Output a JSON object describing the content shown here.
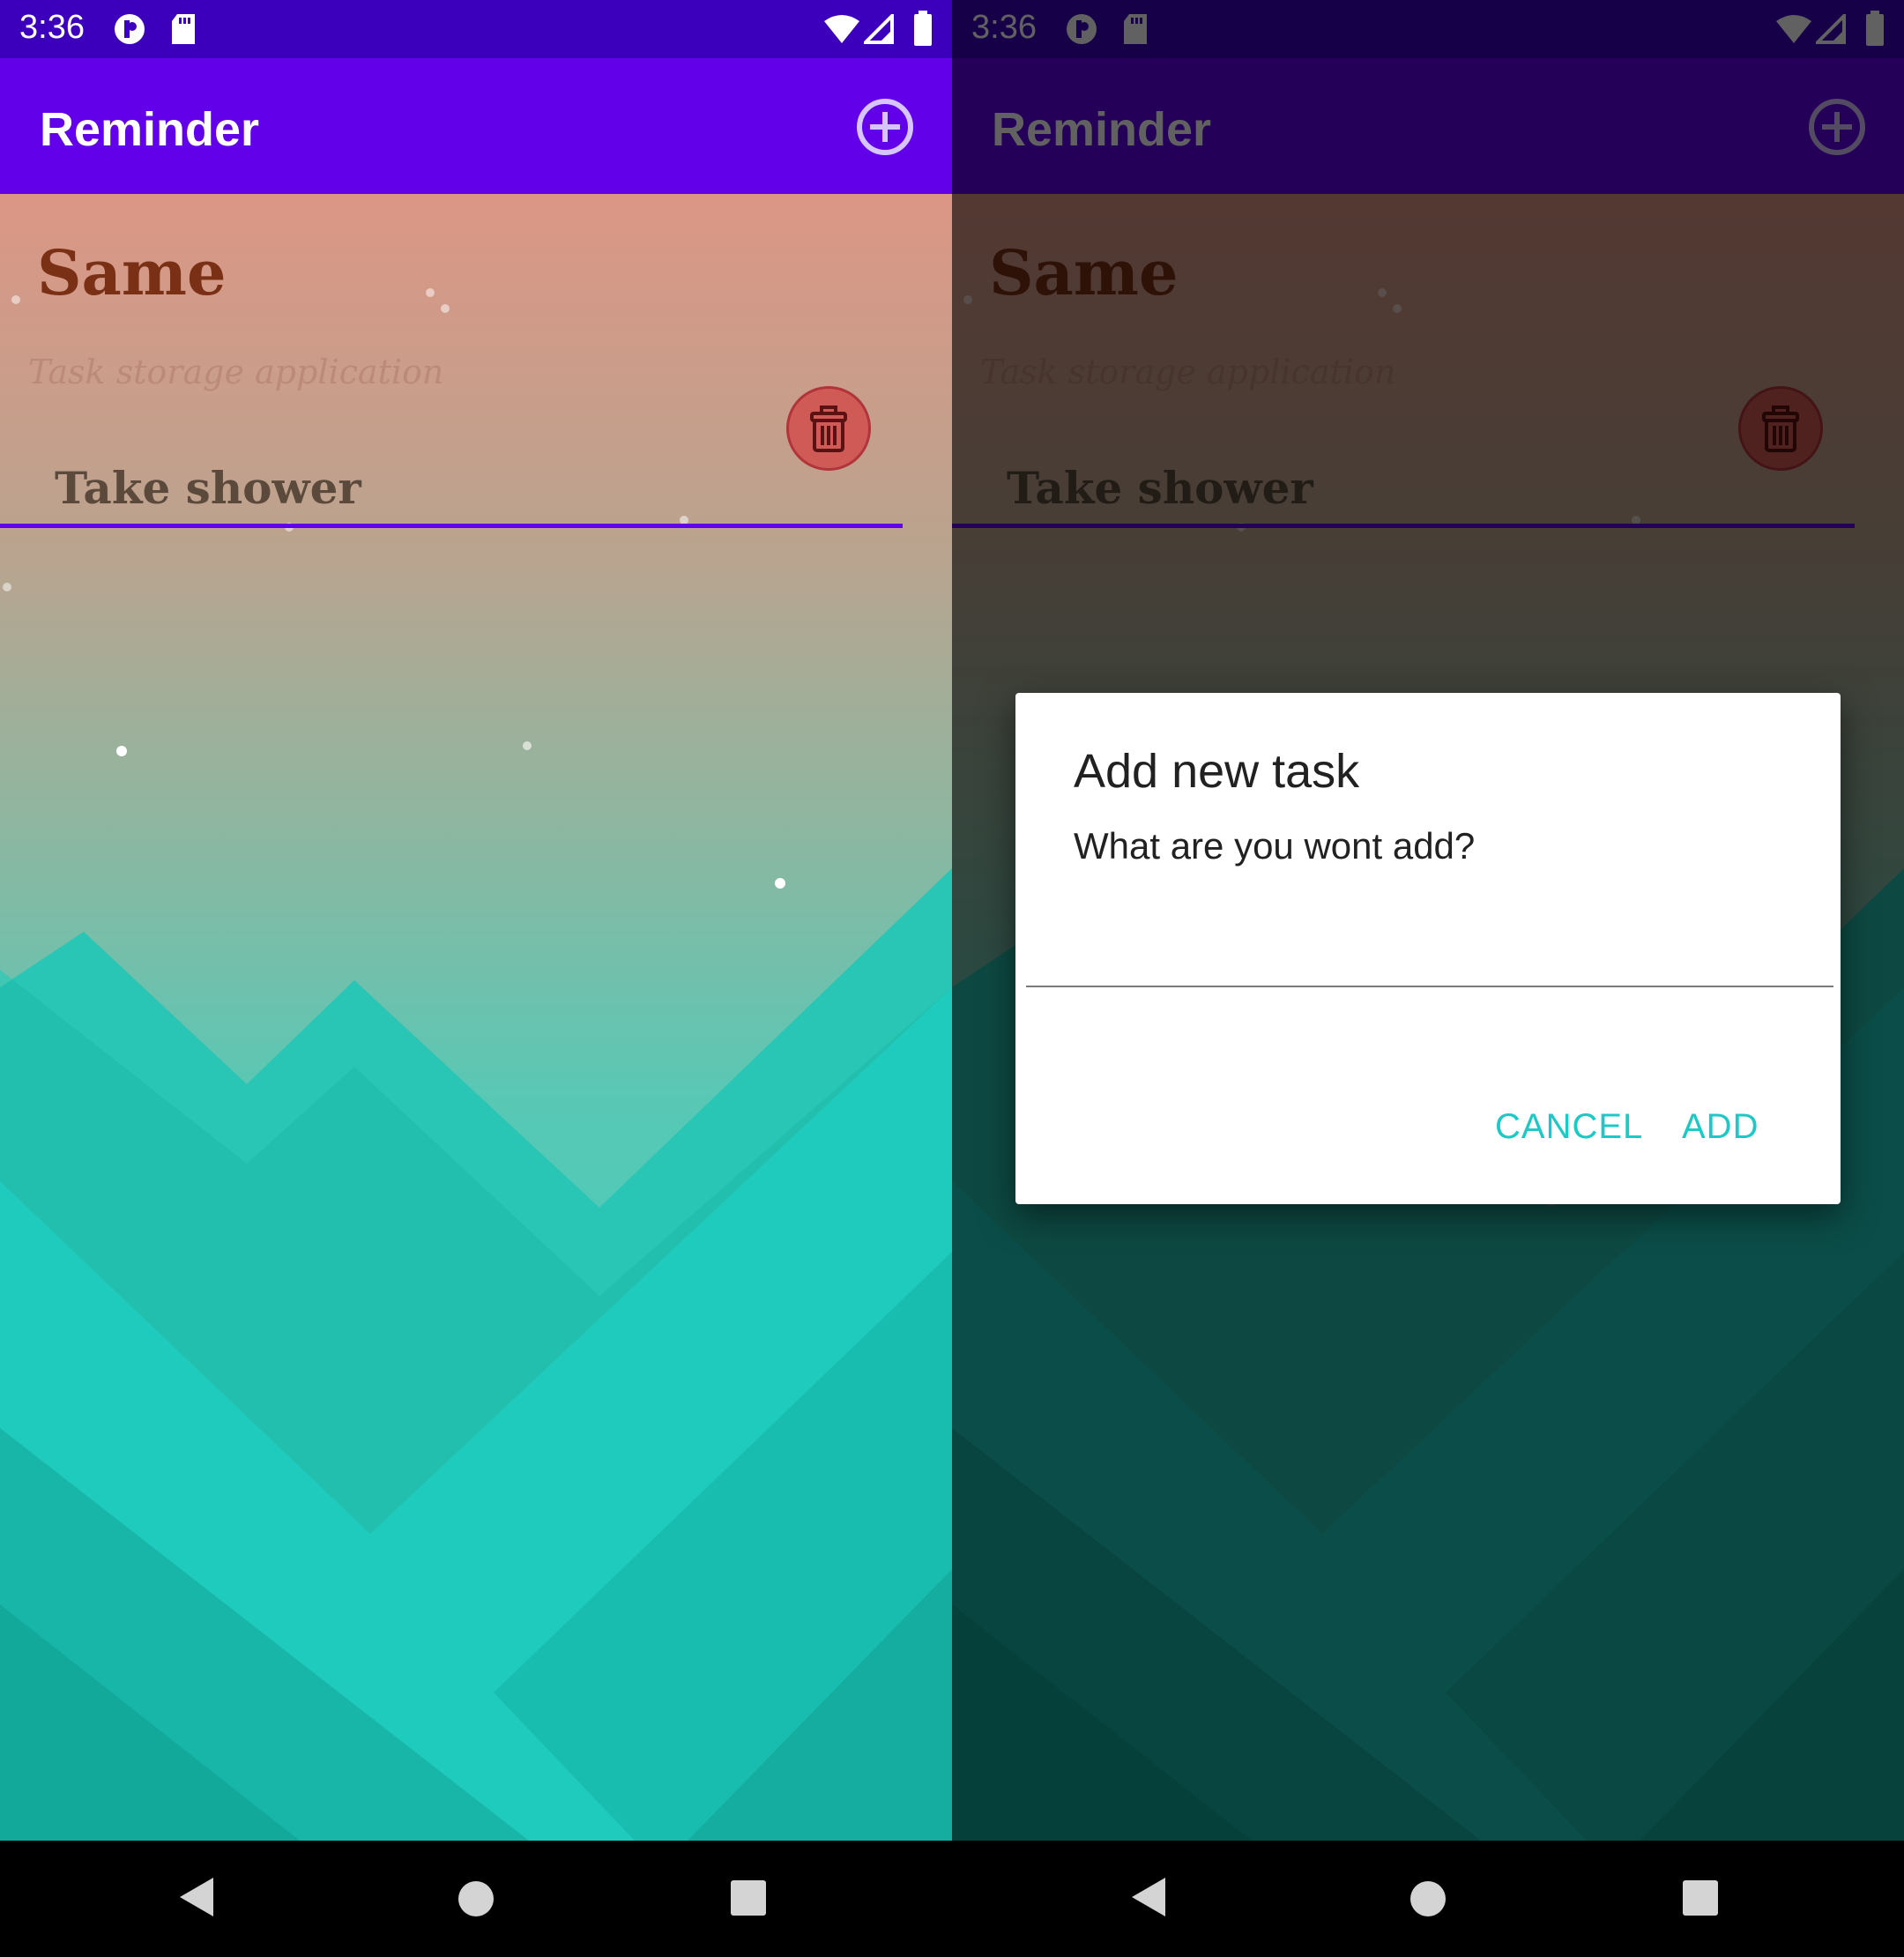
{
  "status_bar": {
    "time": "3:36"
  },
  "app_bar": {
    "title": "Reminder",
    "add_icon": "add-circle-icon"
  },
  "main": {
    "heading": "Same",
    "subheading": "Task storage application",
    "tasks": [
      {
        "label": "Take shower",
        "delete_icon": "trash-icon"
      }
    ]
  },
  "dialog": {
    "title": "Add new task",
    "message": "What are you wont add?",
    "input_value": "",
    "cancel_label": "CANCEL",
    "ok_label": "ADD"
  },
  "colors": {
    "status_bar": "#3c00bd",
    "app_bar": "#6200ea",
    "accent": "#6200ea",
    "dialog_button": "#1ec8c4",
    "delete_button": "#d05a55"
  }
}
